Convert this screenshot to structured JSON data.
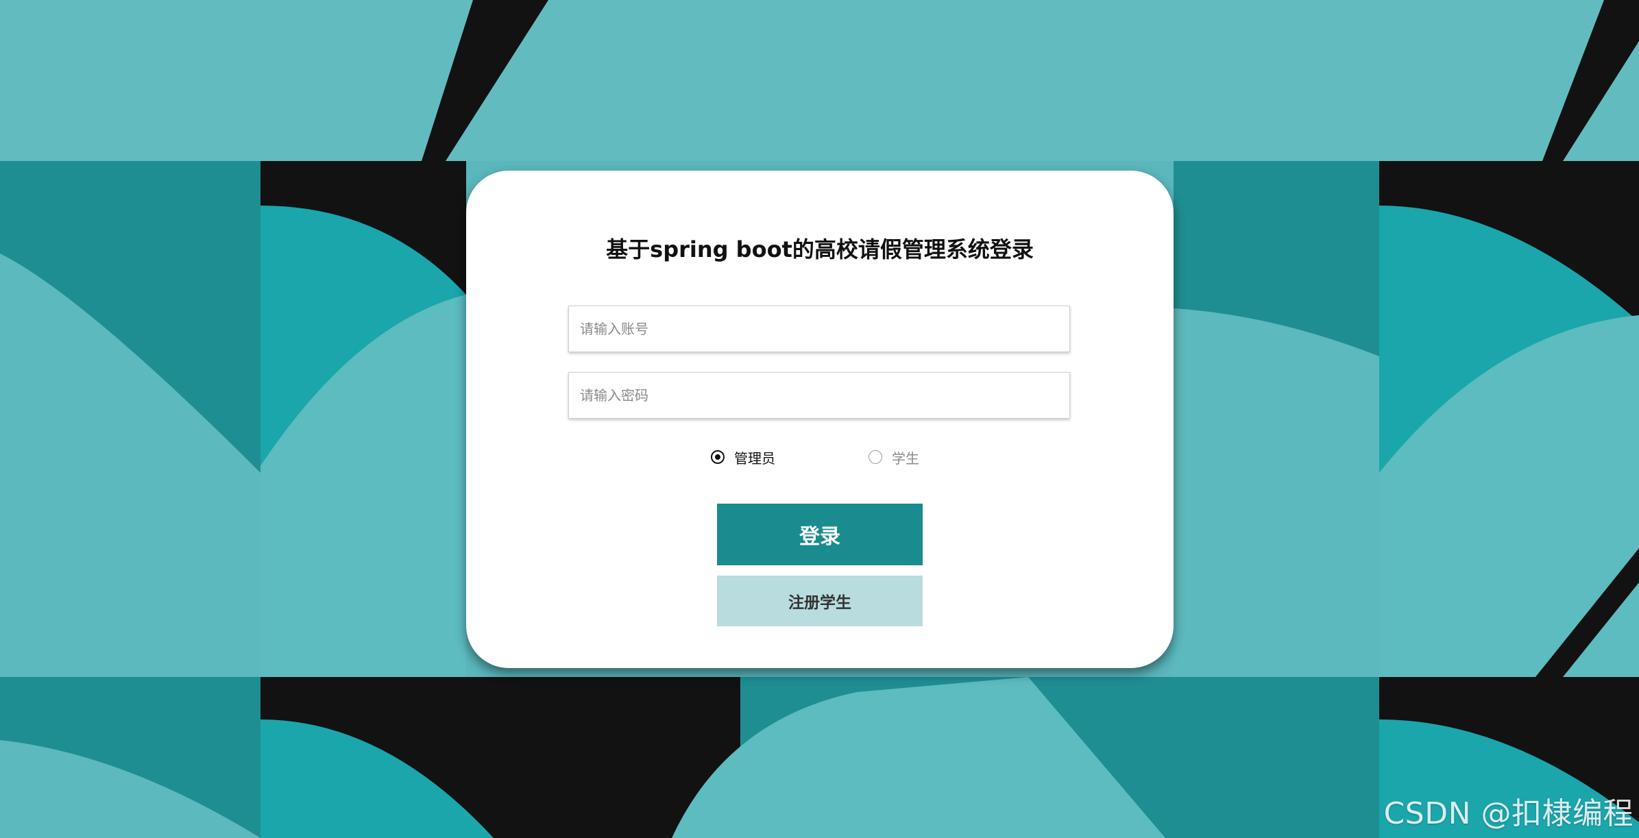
{
  "login": {
    "title": "基于spring boot的高校请假管理系统登录",
    "account_placeholder": "请输入账号",
    "password_placeholder": "请输入密码",
    "roles": [
      {
        "label": "管理员",
        "selected": true
      },
      {
        "label": "学生",
        "selected": false
      }
    ],
    "login_button": "登录",
    "register_button": "注册学生"
  },
  "watermark": "CSDN @扣棣编程",
  "colors": {
    "primary": "#1a8b8f",
    "secondary": "#b9dcde",
    "background_teal": "#5db8bd",
    "background_dark": "#121212",
    "card": "#ffffff"
  }
}
